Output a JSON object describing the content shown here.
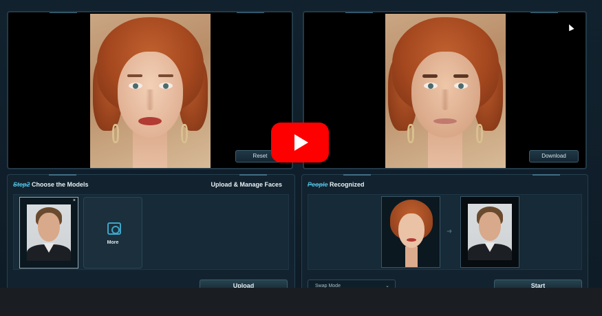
{
  "viewer_source": {
    "reset_label": "Reset"
  },
  "viewer_result": {
    "download_label": "Download"
  },
  "models_section": {
    "step_label": "Step2",
    "title": " Choose the Models",
    "manage_label": "Upload & Manage Faces",
    "close_glyph": "×",
    "more_label": "More",
    "upload_label": "Upload"
  },
  "people_section": {
    "accent_label": "People",
    "title": " Recognized",
    "arrow_glyph": "➜",
    "mode_label": "Swap Mode",
    "mode_chevron": "⌄",
    "start_label": "Start"
  },
  "colors": {
    "accent": "#4fb6d6",
    "play_button": "#ff0000",
    "panel_bg": "#0f1e29"
  }
}
